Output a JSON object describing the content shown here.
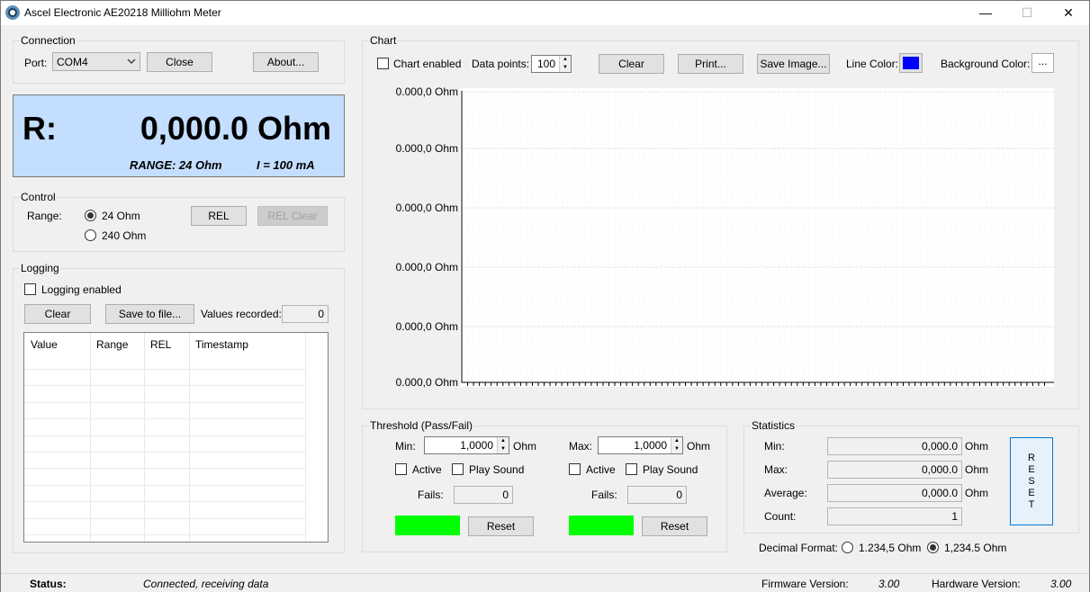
{
  "window": {
    "title": "Ascel Electronic AE20218 Milliohm Meter",
    "minimize": "—",
    "maximize": "☐",
    "close": "✕"
  },
  "connection": {
    "group_title": "Connection",
    "port_label": "Port:",
    "port_value": "COM4",
    "close_button": "Close",
    "about_button": "About..."
  },
  "display": {
    "r_label": "R:",
    "value": "0,000.0 Ohm",
    "range": "RANGE: 24 Ohm",
    "current": "I = 100 mA"
  },
  "control": {
    "group_title": "Control",
    "range_label": "Range:",
    "option_24": "24 Ohm",
    "option_240": "240 Ohm",
    "selected": "24 Ohm",
    "rel_button": "REL",
    "rel_clear_button": "REL Clear"
  },
  "logging": {
    "group_title": "Logging",
    "enabled_label": "Logging enabled",
    "clear_button": "Clear",
    "save_button": "Save to file...",
    "values_recorded_label": "Values recorded:",
    "values_recorded": "0",
    "columns": [
      "Value",
      "Range",
      "REL",
      "Timestamp"
    ]
  },
  "chart": {
    "group_title": "Chart",
    "enabled_label": "Chart enabled",
    "data_points_label": "Data points:",
    "data_points": "100",
    "clear_button": "Clear",
    "print_button": "Print...",
    "save_image_button": "Save Image...",
    "line_color_label": "Line Color:",
    "line_color": "#0000ff",
    "background_color_label": "Background Color:",
    "background_color_button": "...",
    "y_ticks": [
      "0.000,0 Ohm",
      "0.000,0 Ohm",
      "0.000,0 Ohm",
      "0.000,0 Ohm",
      "0.000,0 Ohm",
      "0.000,0 Ohm"
    ]
  },
  "threshold": {
    "group_title": "Threshold (Pass/Fail)",
    "min_label": "Min:",
    "min_value": "1,0000",
    "min_unit": "Ohm",
    "max_label": "Max:",
    "max_value": "1,0000",
    "max_unit": "Ohm",
    "active_label": "Active",
    "play_sound_label": "Play Sound",
    "fails_label": "Fails:",
    "min_fails": "0",
    "max_fails": "0",
    "reset_button": "Reset",
    "indicator_color": "#00ff00"
  },
  "statistics": {
    "group_title": "Statistics",
    "min_label": "Min:",
    "min_value": "0,000.0",
    "max_label": "Max:",
    "max_value": "0,000.0",
    "average_label": "Average:",
    "average_value": "0,000.0",
    "count_label": "Count:",
    "count_value": "1",
    "unit": "Ohm",
    "reset_button": "RESET"
  },
  "decimal_format": {
    "label": "Decimal Format:",
    "option_1": "1.234,5 Ohm",
    "option_2": "1,234.5 Ohm",
    "selected": "1,234.5 Ohm"
  },
  "status": {
    "status_label": "Status:",
    "status_text": "Connected, receiving data",
    "firmware_label": "Firmware Version:",
    "firmware_value": "3.00",
    "hardware_label": "Hardware Version:",
    "hardware_value": "3.00"
  }
}
